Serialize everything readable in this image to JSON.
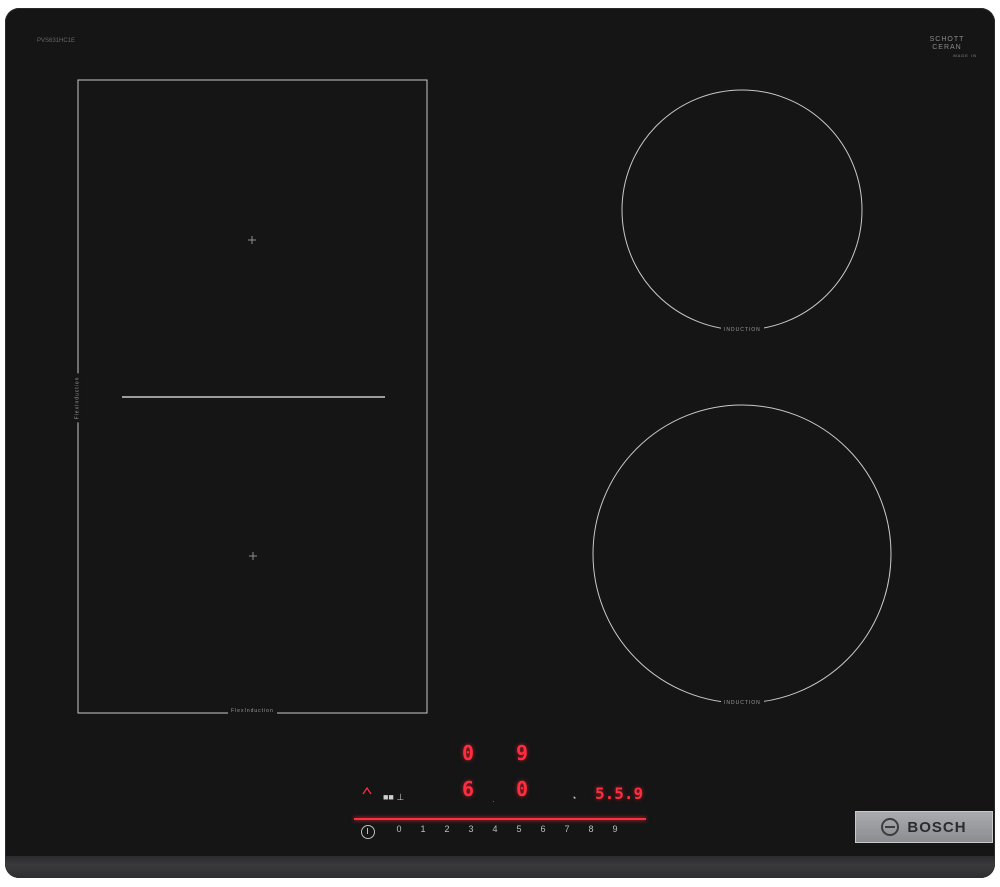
{
  "hob": {
    "model_code": "PVS631HC1E",
    "glass_brand_line1": "SCHOTT",
    "glass_brand_line2": "CERAN",
    "glass_brand_line3": "MADE IN",
    "flex_zone_label": "FlexInduction",
    "flex_side_label": "FlexInduction",
    "zone_top_right_label": "INDUCTION",
    "zone_bottom_right_label": "INDUCTION"
  },
  "controls": {
    "display_top_left": "0",
    "display_top_right": "9",
    "display_mid_left": "6",
    "display_mid_right": "0",
    "timer_display": "5.5.9",
    "scale": [
      "0",
      "1",
      "2",
      "3",
      "4",
      "5",
      "6",
      "7",
      "8",
      "9"
    ]
  },
  "brand": {
    "name": "BOSCH"
  },
  "colors": {
    "glass": "#151515",
    "display_red": "#ff2d3d",
    "outline": "#c9c9c9"
  },
  "icons": [
    "power-icon",
    "boost-icon",
    "timer-icon",
    "lock-icon",
    "bosch-logo-icon"
  ]
}
